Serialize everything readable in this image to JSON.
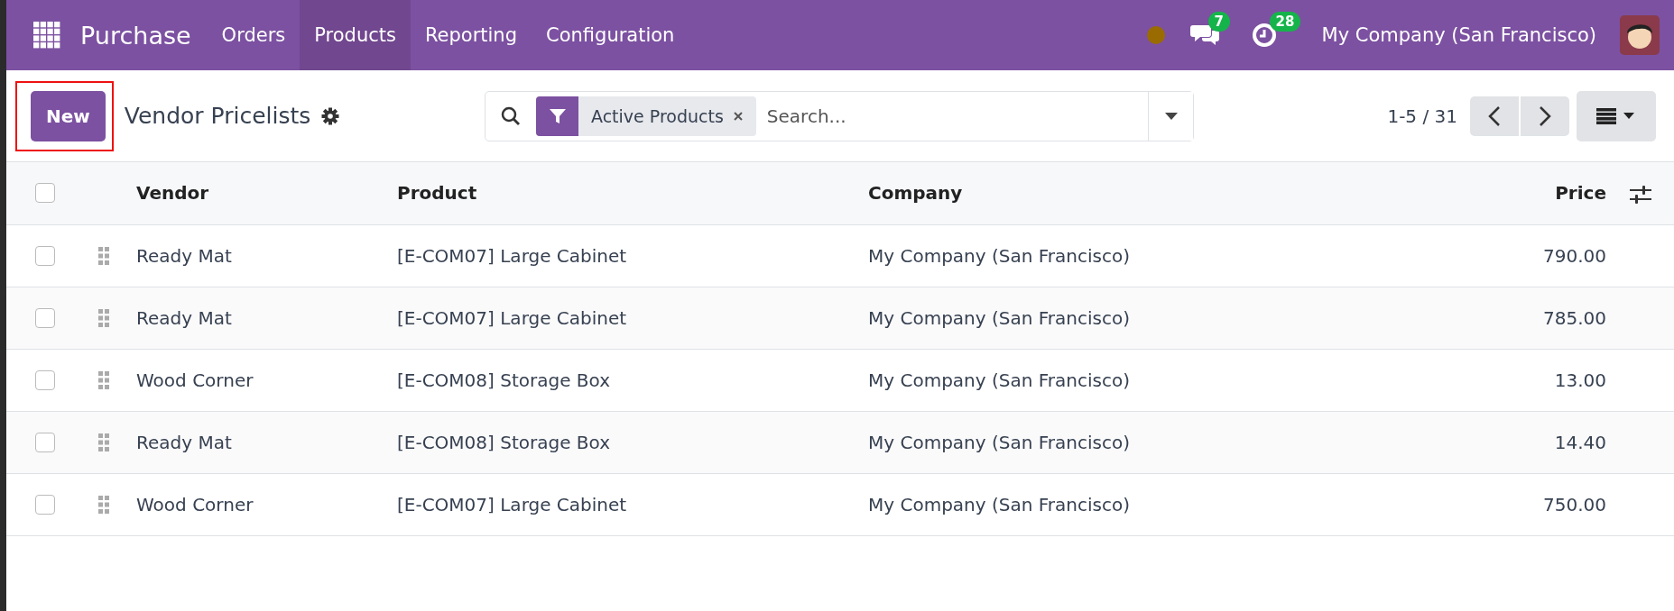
{
  "navbar": {
    "app_name": "Purchase",
    "menu": [
      {
        "label": "Orders",
        "selected": false
      },
      {
        "label": "Products",
        "selected": true
      },
      {
        "label": "Reporting",
        "selected": false
      },
      {
        "label": "Configuration",
        "selected": false
      }
    ],
    "messages_badge": "7",
    "activities_badge": "28",
    "company": "My Company (San Francisco)"
  },
  "control_panel": {
    "new_button": "New",
    "highlighted": true,
    "title": "Vendor Pricelists",
    "search": {
      "facets": [
        {
          "label": "Active Products"
        }
      ],
      "placeholder": "Search..."
    },
    "pager": "1-5 / 31"
  },
  "table": {
    "select_all": {
      "checked": false
    },
    "columns": [
      "Vendor",
      "Product",
      "Company",
      "Price"
    ],
    "rows": [
      {
        "vendor": "Ready Mat",
        "product": "[E-COM07] Large Cabinet",
        "company": "My Company (San Francisco)",
        "price": "790.00",
        "checked": false
      },
      {
        "vendor": "Ready Mat",
        "product": "[E-COM07] Large Cabinet",
        "company": "My Company (San Francisco)",
        "price": "785.00",
        "checked": false
      },
      {
        "vendor": "Wood Corner",
        "product": "[E-COM08] Storage Box",
        "company": "My Company (San Francisco)",
        "price": "13.00",
        "checked": false
      },
      {
        "vendor": "Ready Mat",
        "product": "[E-COM08] Storage Box",
        "company": "My Company (San Francisco)",
        "price": "14.40",
        "checked": false
      },
      {
        "vendor": "Wood Corner",
        "product": "[E-COM07] Large Cabinet",
        "company": "My Company (San Francisco)",
        "price": "750.00",
        "checked": false
      }
    ]
  }
}
